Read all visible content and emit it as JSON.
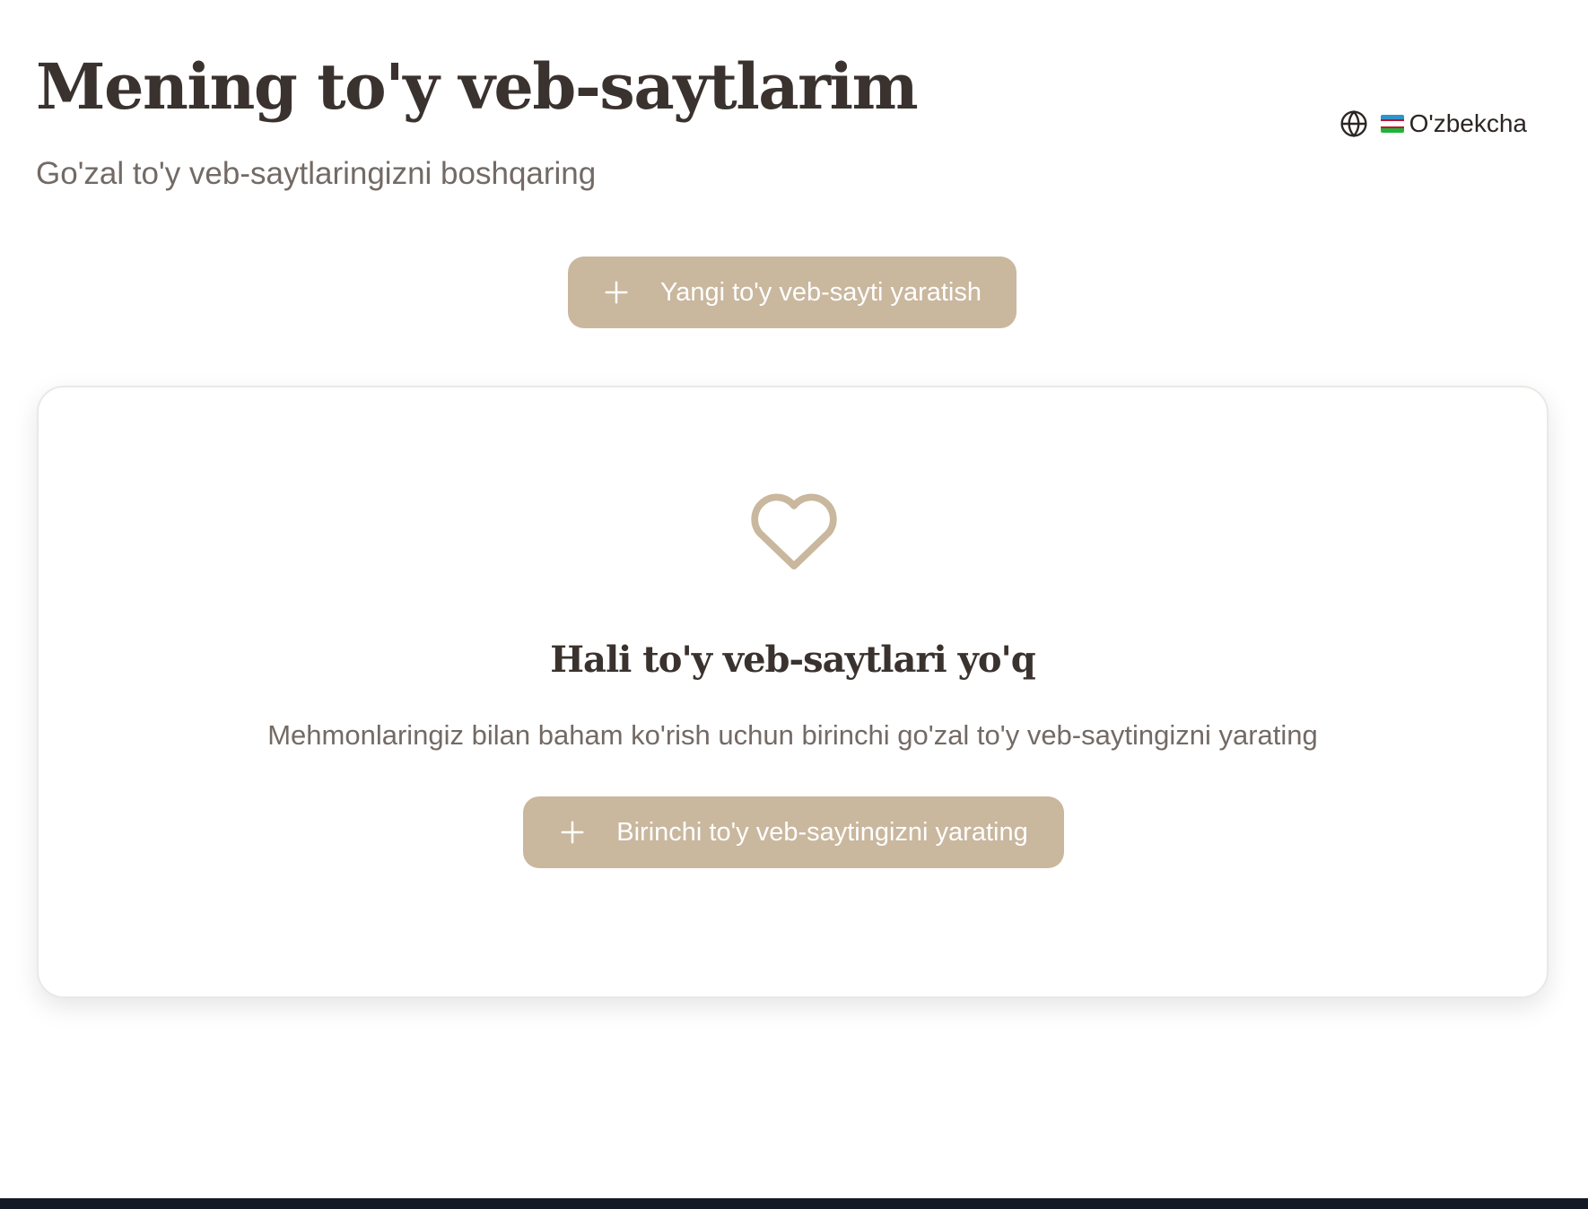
{
  "header": {
    "title": "Mening to'y veb-saytlarim",
    "subtitle": "Go'zal to'y veb-saytlaringizni boshqaring"
  },
  "language": {
    "icon": "globe-icon",
    "flag_icon": "uzbekistan-flag-icon",
    "label": "O'zbekcha"
  },
  "actions": {
    "create_label": "Yangi to'y veb-sayti yaratish",
    "create_icon": "plus-icon"
  },
  "empty_state": {
    "icon": "heart-icon",
    "title": "Hali to'y veb-saytlari yo'q",
    "description": "Mehmonlaringiz bilan baham ko'rish uchun birinchi go'zal to'y veb-saytingizni yarating",
    "button_label": "Birinchi to'y veb-saytingizni yarating",
    "button_icon": "plus-icon"
  },
  "colors": {
    "accent": "#c9b79e",
    "title_text": "#3a322e",
    "muted_text": "#736a65",
    "footer_bar": "#141a26"
  }
}
